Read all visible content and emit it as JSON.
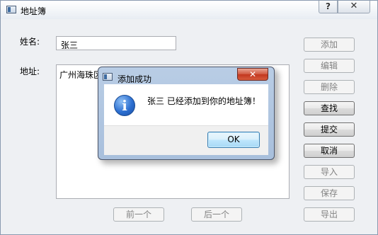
{
  "window": {
    "title": "地址簿",
    "help": "?",
    "close": "✕"
  },
  "form": {
    "name_label": "姓名:",
    "name_value": "张三",
    "address_label": "地址:",
    "address_value": "广州海珠区"
  },
  "buttons": {
    "add": "添加",
    "edit": "编辑",
    "delete": "删除",
    "find": "查找",
    "submit": "提交",
    "cancel": "取消",
    "import": "导入",
    "save": "保存",
    "export": "导出",
    "previous": "前一个",
    "next": "后一个"
  },
  "dialog": {
    "title": "添加成功",
    "message": "张三 已经添加到你的地址簿！",
    "ok": "OK",
    "close": "✕",
    "icon": "i"
  }
}
